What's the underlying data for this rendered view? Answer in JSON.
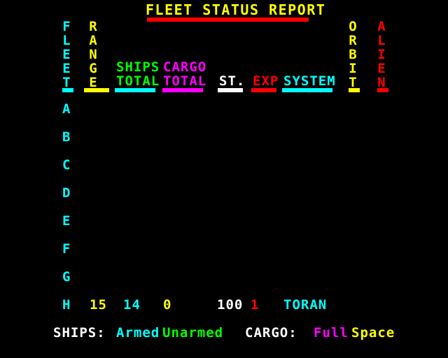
{
  "screen": {
    "background": "#000000",
    "title": "FLEET STATUS REPORT",
    "title_color": "#FFFF00",
    "title_rule_color": "#FF0000"
  },
  "colors": {
    "yellow": "#FFFF00",
    "cyan": "#00FFFF",
    "green": "#00FF00",
    "magenta": "#FF00FF",
    "white": "#FFFFFF",
    "red": "#FF0000",
    "black": "#000000"
  },
  "columns": {
    "fleet": {
      "label": "FLEET",
      "orientation": "vertical",
      "color": "#00FFFF",
      "letters": [
        "F",
        "L",
        "E",
        "E",
        "T"
      ]
    },
    "range": {
      "label": "RANGE",
      "orientation": "vertical",
      "color": "#FFFF00",
      "letters": [
        "R",
        "A",
        "N",
        "G",
        "E"
      ]
    },
    "ships_total": {
      "line1": "SHIPS",
      "line2": "TOTAL",
      "color": "#00FF00",
      "rule_color": "#00FFFF"
    },
    "cargo_total": {
      "line1": "CARGO",
      "line2": "TOTAL",
      "color": "#FF00FF",
      "rule_color": "#FF00FF"
    },
    "st": {
      "label": "ST.",
      "color": "#FFFFFF",
      "rule_color": "#FFFFFF"
    },
    "exp": {
      "label": "EXP",
      "color": "#FF0000",
      "rule_color": "#FF0000"
    },
    "system": {
      "label": "SYSTEM",
      "color": "#00FFFF",
      "rule_color": "#00FFFF"
    },
    "orbit": {
      "label": "ORBIT",
      "orientation": "vertical",
      "color": "#FFFF00",
      "letters": [
        "O",
        "R",
        "B",
        "I",
        "T"
      ],
      "rule_color": "#FFFF00"
    },
    "alien": {
      "label": "ALIEN",
      "orientation": "vertical",
      "color": "#FF0000",
      "letters": [
        "A",
        "L",
        "I",
        "E",
        "N"
      ],
      "rule_color": "#FF0000"
    }
  },
  "rows": [
    {
      "fleet": "A",
      "range": "",
      "ships_total": "",
      "cargo_total": "",
      "st": "",
      "exp": "",
      "system": ""
    },
    {
      "fleet": "B",
      "range": "",
      "ships_total": "",
      "cargo_total": "",
      "st": "",
      "exp": "",
      "system": ""
    },
    {
      "fleet": "C",
      "range": "",
      "ships_total": "",
      "cargo_total": "",
      "st": "",
      "exp": "",
      "system": ""
    },
    {
      "fleet": "D",
      "range": "",
      "ships_total": "",
      "cargo_total": "",
      "st": "",
      "exp": "",
      "system": ""
    },
    {
      "fleet": "E",
      "range": "",
      "ships_total": "",
      "cargo_total": "",
      "st": "",
      "exp": "",
      "system": ""
    },
    {
      "fleet": "F",
      "range": "",
      "ships_total": "",
      "cargo_total": "",
      "st": "",
      "exp": "",
      "system": ""
    },
    {
      "fleet": "G",
      "range": "",
      "ships_total": "",
      "cargo_total": "",
      "st": "",
      "exp": "",
      "system": ""
    },
    {
      "fleet": "H",
      "range": "15",
      "ships_total": "14",
      "cargo_total": "0",
      "st": "100",
      "exp": "1",
      "system": "TORAN"
    }
  ],
  "legend": {
    "ships_label": "SHIPS:",
    "ships_armed": "Armed",
    "ships_unarmed": "Unarmed",
    "cargo_label": "CARGO:",
    "cargo_full": "Full",
    "cargo_space": "Space"
  }
}
